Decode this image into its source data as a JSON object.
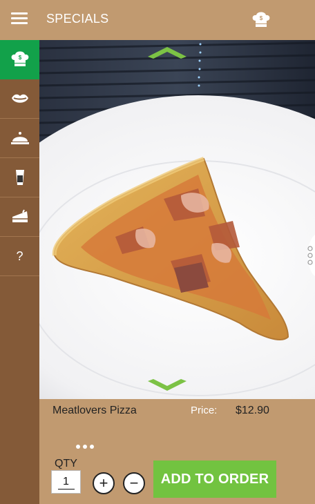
{
  "header": {
    "title": "SPECIALS",
    "menu_icon": "hamburger-menu-icon",
    "cart_icon": "chef-hat-price-icon"
  },
  "sidebar": {
    "items": [
      {
        "icon": "chef-hat-specials-icon",
        "active": true
      },
      {
        "icon": "lips-appetizers-icon",
        "active": false
      },
      {
        "icon": "serving-cloche-entrees-icon",
        "active": false
      },
      {
        "icon": "drink-glass-icon",
        "active": false
      },
      {
        "icon": "cake-slice-dessert-icon",
        "active": false
      },
      {
        "icon": "question-help-icon",
        "label": "?",
        "active": false
      }
    ]
  },
  "viewer": {
    "up_icon": "chevron-up-icon",
    "down_icon": "chevron-down-icon",
    "side_handle_icon": "vertical-dots-handle-icon",
    "item_image": "pizza-slice-3d-model"
  },
  "product": {
    "name": "Meatlovers Pizza",
    "price_label": "Price:",
    "price": "$12.90"
  },
  "order": {
    "qty_label": "QTY",
    "qty_value": "1",
    "plus_label": "+",
    "minus_label": "−",
    "add_label": "ADD TO ORDER",
    "more_icon": "three-dots-icon"
  },
  "colors": {
    "brand_tan": "#c19a70",
    "sidebar_brown": "#845a38",
    "active_green": "#12a14a",
    "accent_green": "#72c340"
  }
}
